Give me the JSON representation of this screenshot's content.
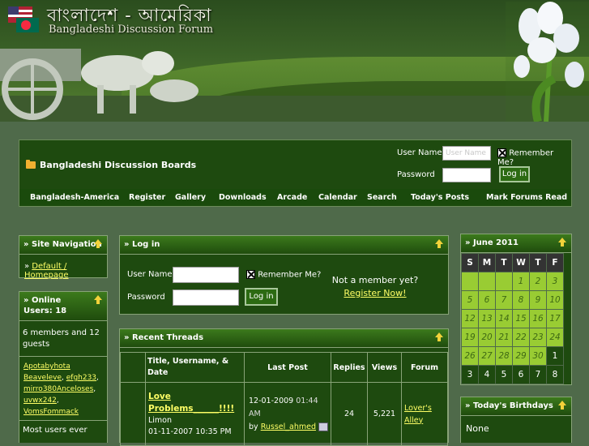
{
  "header": {
    "title_bn": "বাংলাদেশ - আমেরিকা",
    "title_en": "Bangladeshi Discussion Forum"
  },
  "topbar": {
    "breadcrumb": "Bangladeshi Discussion Boards",
    "username_label": "User Name",
    "username_placeholder": "User Name",
    "password_label": "Password",
    "remember_label": "Remember Me?",
    "login_label": "Log in"
  },
  "nav": [
    "Bangladesh-America",
    "Register",
    "Gallery",
    "Downloads",
    "Arcade",
    "Calendar",
    "Search",
    "Today's Posts",
    "Mark Forums Read"
  ],
  "site_nav": {
    "title": "» Site Navigation",
    "link": "Default / Homepage",
    "link_prefix": "» "
  },
  "online": {
    "title": "» Online Users: 18",
    "summary": "6 members and 12 guests",
    "users": [
      "Apotabyhota",
      "Beaveleve",
      "efgh233",
      "mirro380Anceloses",
      "uvwx242",
      "VomsFommack"
    ],
    "footer": "Most users ever"
  },
  "login": {
    "title": "» Log in",
    "username_label": "User Name",
    "password_label": "Password",
    "remember_label": "Remember Me?",
    "button": "Log in",
    "not_member": "Not a member yet?",
    "register": "Register Now!"
  },
  "recent": {
    "title": "» Recent Threads",
    "columns": [
      "Title, Username, & Date",
      "Last Post",
      "Replies",
      "Views",
      "Forum"
    ],
    "rows": [
      {
        "title": "Love Problems______!!!!",
        "user": "Limon",
        "date": "01-11-2007 10:35 PM",
        "last_date": "12-01-2009",
        "last_time": "01:44 AM",
        "last_by_prefix": "by",
        "last_by": "Russel_ahmed",
        "replies": "24",
        "views": "5,221",
        "forum": "Lover's Alley"
      }
    ]
  },
  "calendar": {
    "title": "» June 2011",
    "days": [
      "S",
      "M",
      "T",
      "W",
      "T",
      "F"
    ],
    "weeks": [
      [
        {
          "v": "",
          "c": "g"
        },
        {
          "v": "",
          "c": "g"
        },
        {
          "v": "",
          "c": "g"
        },
        {
          "v": "1",
          "c": "g"
        },
        {
          "v": "2",
          "c": "g"
        },
        {
          "v": "3",
          "c": "g"
        }
      ],
      [
        {
          "v": "5",
          "c": "g"
        },
        {
          "v": "6",
          "c": "g"
        },
        {
          "v": "7",
          "c": "g"
        },
        {
          "v": "8",
          "c": "g"
        },
        {
          "v": "9",
          "c": "g"
        },
        {
          "v": "10",
          "c": "g"
        }
      ],
      [
        {
          "v": "12",
          "c": "g"
        },
        {
          "v": "13",
          "c": "g"
        },
        {
          "v": "14",
          "c": "g"
        },
        {
          "v": "15",
          "c": "g"
        },
        {
          "v": "16",
          "c": "g"
        },
        {
          "v": "17",
          "c": "g"
        }
      ],
      [
        {
          "v": "19",
          "c": "g"
        },
        {
          "v": "20",
          "c": "g"
        },
        {
          "v": "21",
          "c": "g"
        },
        {
          "v": "22",
          "c": "g"
        },
        {
          "v": "23",
          "c": "g"
        },
        {
          "v": "24",
          "c": "g"
        }
      ],
      [
        {
          "v": "26",
          "c": "g"
        },
        {
          "v": "27",
          "c": "g"
        },
        {
          "v": "28",
          "c": "g"
        },
        {
          "v": "29",
          "c": "g"
        },
        {
          "v": "30",
          "c": "g"
        },
        {
          "v": "1",
          "c": "d"
        }
      ],
      [
        {
          "v": "3",
          "c": "d"
        },
        {
          "v": "4",
          "c": "d"
        },
        {
          "v": "5",
          "c": "d"
        },
        {
          "v": "6",
          "c": "d"
        },
        {
          "v": "7",
          "c": "d"
        },
        {
          "v": "8",
          "c": "d"
        }
      ]
    ]
  },
  "birthdays": {
    "title": "» Today's Birthdays",
    "body": "None"
  },
  "colors": {
    "accent": "#1e4a0f",
    "link": "#ffff66",
    "calendar_highlight": "#99cc33"
  }
}
